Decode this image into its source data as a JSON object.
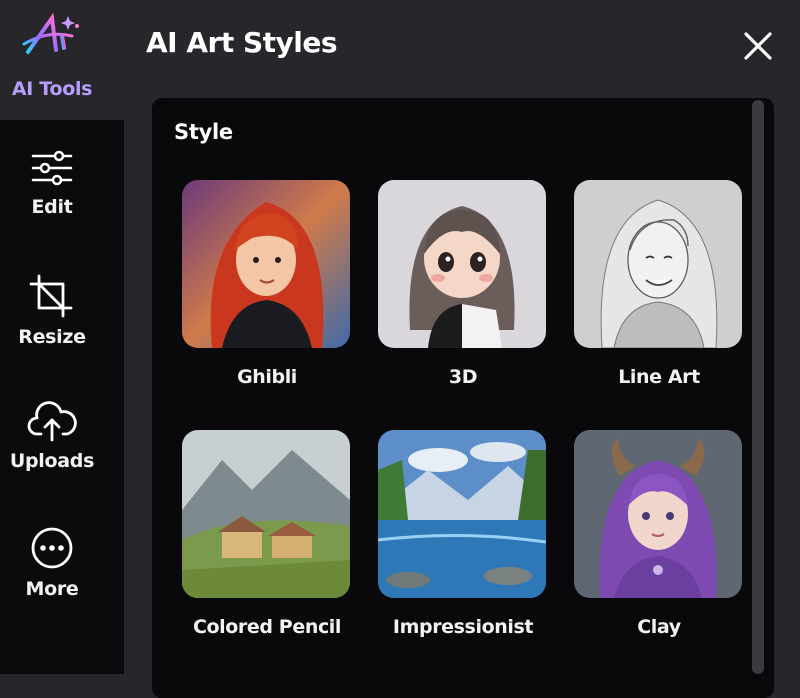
{
  "header": {
    "title": "AI Art Styles"
  },
  "sidebar": {
    "top_label": "AI Tools",
    "items": [
      {
        "label": "Edit",
        "icon": "sliders-icon"
      },
      {
        "label": "Resize",
        "icon": "crop-icon"
      },
      {
        "label": "Uploads",
        "icon": "cloud-upload-icon"
      },
      {
        "label": "More",
        "icon": "more-dots-icon"
      }
    ]
  },
  "panel": {
    "section_title": "Style",
    "styles": [
      {
        "label": "Ghibli",
        "thumbnail": "ghibli-portrait-thumbnail"
      },
      {
        "label": "3D",
        "thumbnail": "3d-doll-thumbnail"
      },
      {
        "label": "Line Art",
        "thumbnail": "line-art-sketch-thumbnail"
      },
      {
        "label": "Colored Pencil",
        "thumbnail": "colored-pencil-village-thumbnail"
      },
      {
        "label": "Impressionist",
        "thumbnail": "impressionist-lake-thumbnail"
      },
      {
        "label": "Clay",
        "thumbnail": "clay-horned-girl-thumbnail"
      }
    ]
  },
  "colors": {
    "background": "#26262b",
    "rail": "#0b0b0d",
    "panel": "#09090b",
    "accent": "#b89cff",
    "text": "#ffffff"
  }
}
